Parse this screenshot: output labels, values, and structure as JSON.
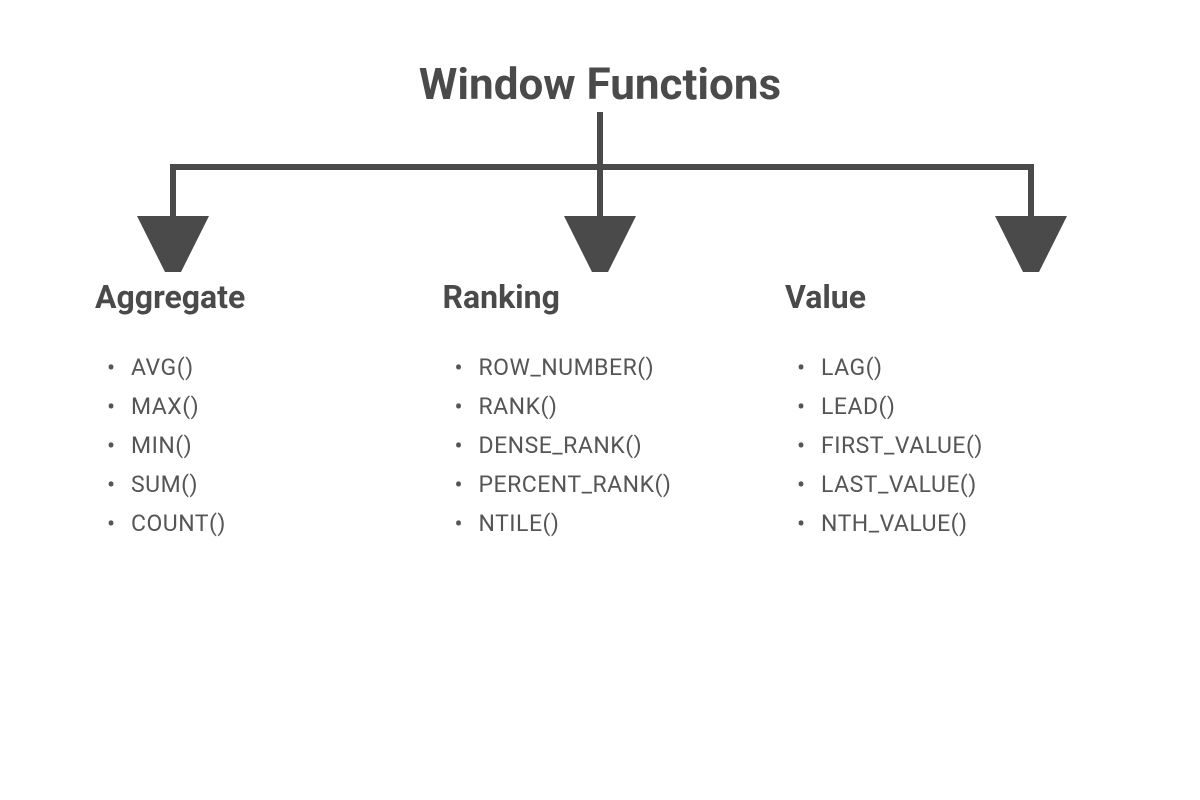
{
  "title": "Window Functions",
  "branches": [
    {
      "heading": "Aggregate",
      "items": [
        "AVG()",
        "MAX()",
        "MIN()",
        "SUM()",
        "COUNT()"
      ]
    },
    {
      "heading": "Ranking",
      "items": [
        "ROW_NUMBER()",
        "RANK()",
        "DENSE_RANK()",
        "PERCENT_RANK()",
        "NTILE()"
      ]
    },
    {
      "heading": "Value",
      "items": [
        "LAG()",
        "LEAD()",
        "FIRST_VALUE()",
        "LAST_VALUE()",
        "NTH_VALUE()"
      ]
    }
  ],
  "colors": {
    "text": "#4a4a4a",
    "line": "#4a4a4a"
  }
}
